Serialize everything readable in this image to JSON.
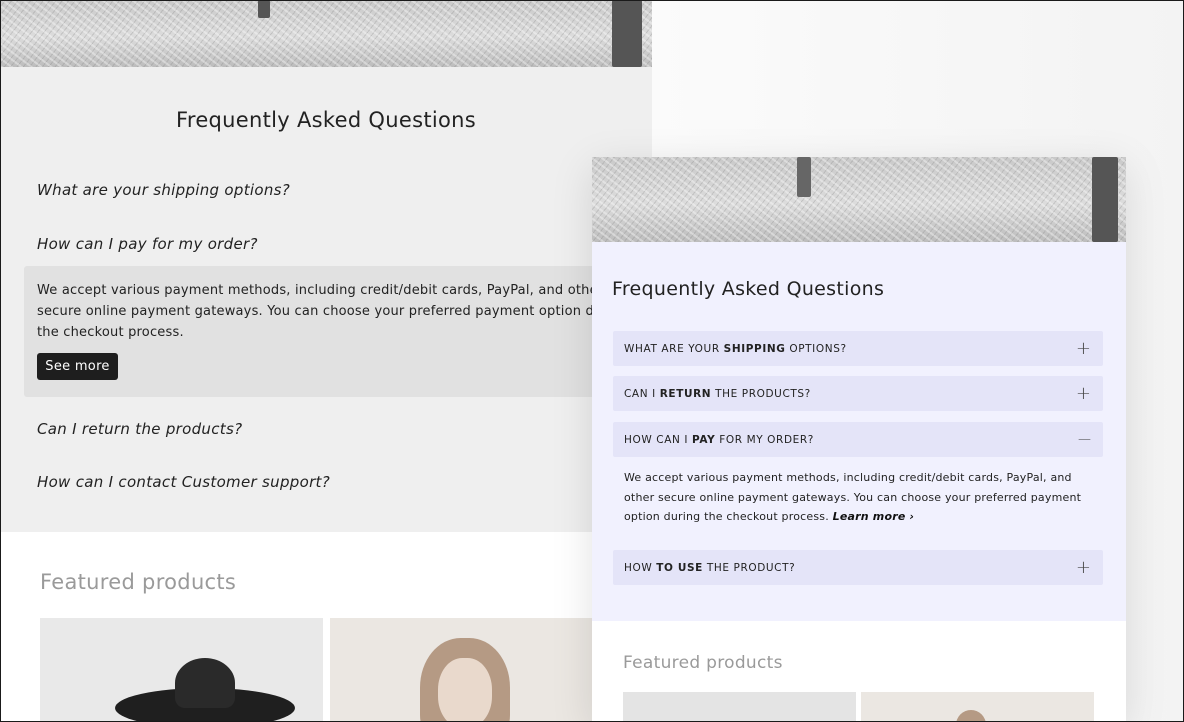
{
  "back": {
    "title": "Frequently Asked Questions",
    "questions": [
      "What are your shipping options?",
      "How can I pay for my order?",
      "Can I return the products?",
      "How can I contact Customer support?"
    ],
    "answer": "We accept various payment methods, including credit/debit cards, PayPal, and other secure online payment gateways. You can choose your preferred payment option during the checkout process.",
    "see_more_label": "See more",
    "featured_title": "Featured products"
  },
  "front": {
    "title": "Frequently Asked Questions",
    "accordion": [
      {
        "pre": "WHAT ARE YOUR ",
        "bold": "SHIPPING",
        "post": " OPTIONS?",
        "icon": "+",
        "expanded": false
      },
      {
        "pre": "CAN I ",
        "bold": "RETURN",
        "post": " THE PRODUCTS?",
        "icon": "+",
        "expanded": false
      },
      {
        "pre": "HOW CAN I ",
        "bold": "PAY",
        "post": " FOR MY ORDER?",
        "icon": "—",
        "expanded": true
      },
      {
        "pre": "HOW ",
        "bold": "TO USE",
        "post": " THE PRODUCT?",
        "icon": "+",
        "expanded": false
      }
    ],
    "answer": "We accept various payment methods, including credit/debit cards, PayPal, and other secure online payment gateways. You can choose your preferred payment option during the checkout process.",
    "learn_more_label": "Learn more ›",
    "featured_title": "Featured products"
  },
  "colors": {
    "back_faq_bg": "#efefef",
    "front_faq_bg": "#f1f1fe",
    "accordion_bg": "#e4e4f8",
    "button_bg": "#1e1e1e"
  },
  "icons": [
    "plus-icon",
    "minus-icon"
  ]
}
